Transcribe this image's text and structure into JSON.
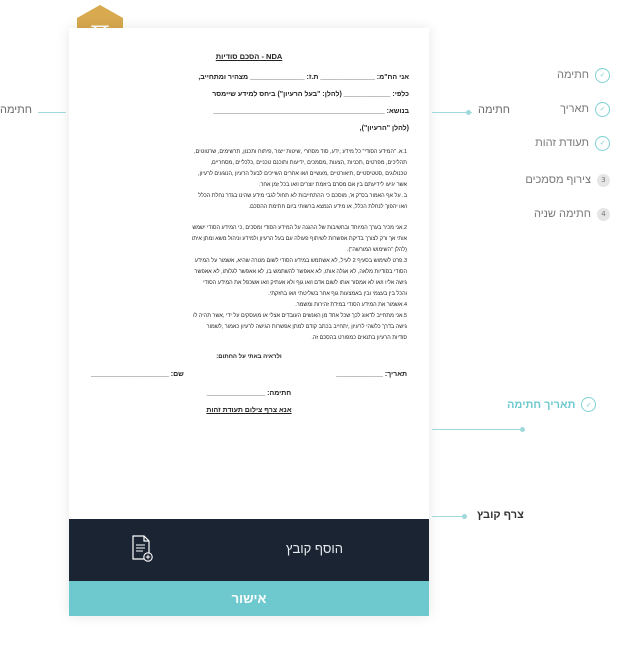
{
  "document": {
    "title": "NDA - הסכם סודיות",
    "line1": "אני הח\"מ: ______________ ת.ז: ______________ מצהיר ומתחייב,",
    "line2": "כלפי: ____________ (להלן: \"בעל הרעיון\") ביחס למידע שיימסר",
    "line3": "בנושא: ____________________________________________",
    "line4": "(להלן \"הרעיון\"),",
    "p1": [
      "1.א. \"המידע הסודי\" כל מידע ,ידע, סוד מסחרי ,שיטות ייצור ,פיתוח ותכנון, תרשימים, שרטוטים,",
      "תהליכים, מפרטים ,תכניות ,הצעות ,מסמכים ,ידיעות ותוכנם טכניים ,כלכליים ,מסחריים,",
      "טכנולוגים ,סטטיסטיים ,תיאורטיים ,מעשיים ו/או אחרים השייכים לבעל הרעיון ,הנוגעים לרעיון,",
      "אשר יגיעו לידיעתם בין אם מסרם ביוזמת יוצרים ו/או בכל זמן אחר.",
      "ב. על אף האמור בס\"ק א', מוסכם כי ההתחייבות לא תחול לגבי מידע שהינו בגדר נחלת הכלל",
      "ו/או יהפוך לנחלת הכלל, או מידע הנמצא ברשותי ביום חתימת ההסכם."
    ],
    "p2": [
      "2.אני מכיר בערך המיוחד ובחשיבות של ההגנה על המידע הסודי ומסכים ,כי המידע הסודי ישמש",
      "אותי אך ורק לצורך בדיקת אפשרות לשיתוף פעולה עם בעל הרעיון ולמידע וניהול משא ומתן איתו",
      "(להלן \"השימוש המורשה\").",
      "3.פרט לשימוש בסעיף 2 לעיל, לא אשתמש במידע הסודי לשום מטרה שהיא, אשמור על המידע",
      "הסודי בסודיות מלאה, לא אגלה אותו, לא אאפשר להשתמש בו, לא אאפשר לגלותו, לא אאפשר",
      "גישה אליו ו/או לא אמסור אותו לשום אדם ו/או גוף ולא אעתיק ו/או אשכפל את המידע הסודי",
      "והכל בין בעצמי ובין באמצעות גוף אחר בשליטתי ו/או בחזקתי.",
      "4.אשמור את המידע הסודי במידת זהירות ומשמר.",
      "5.אני מתחייב לדאוג לכך שכל אחד מן האנשים העובדים אצלי או מועסקים על ידי ,אשר תהיה לו",
      "גישה בדרך כלשהי לרעיון ,יתחייב בכתב קודם למתן אפשרות הגישה לרעיון כאמור ,לשמור",
      "סודיות הרעיון בתנאים כמפורט בהסכם זה."
    ],
    "witness": "ולראיה באתי על החתום:",
    "date_label": "תאריך: ____________",
    "name_label": "שם: ____________________",
    "signature_label": "חתימה: _______________",
    "id_link": "אנא צרף צילום תעודת זהות"
  },
  "attach": {
    "label": "הוסף קובץ",
    "icon": "file-add-icon"
  },
  "confirm_label": "אישור",
  "annotations": {
    "left_signature": "חתימה",
    "right_signature": "חתימה",
    "attach_file": "צרף קובץ"
  },
  "steps": [
    {
      "label": "חתימה",
      "state": "done",
      "number": ""
    },
    {
      "label": "תאריך",
      "state": "done",
      "number": ""
    },
    {
      "label": "תעודת זהות",
      "state": "done",
      "number": ""
    },
    {
      "label": "צירוף מסמכים",
      "state": "pending",
      "number": "3"
    },
    {
      "label": "חתימה שניה",
      "state": "pending",
      "number": "4"
    }
  ],
  "date_signature": "תאריך חתימה",
  "colors": {
    "accent": "#6ec9ce",
    "dark": "#1a2433",
    "logo": "#d8a94e"
  }
}
